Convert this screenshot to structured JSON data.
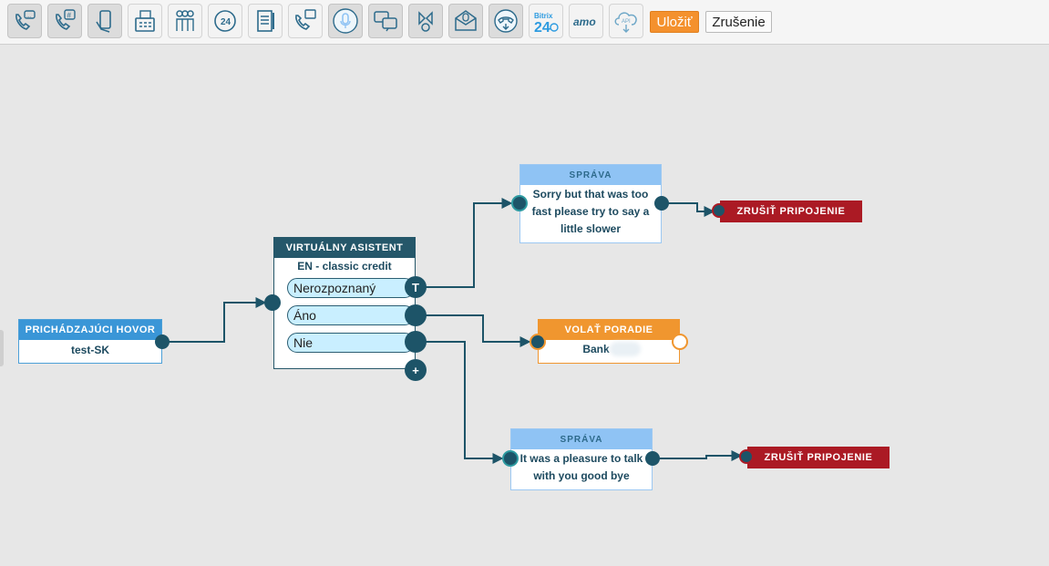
{
  "toolbar": {
    "tools": [
      {
        "icon": "sms-call-icon"
      },
      {
        "icon": "hash-call-icon"
      },
      {
        "icon": "mobile-hand-icon"
      },
      {
        "icon": "fax-icon"
      },
      {
        "icon": "people-queue-icon"
      },
      {
        "icon": "hours-24-icon"
      },
      {
        "icon": "notepad-icon"
      },
      {
        "icon": "call-transfer-icon"
      },
      {
        "icon": "microphone-icon"
      },
      {
        "icon": "chat-bubbles-icon"
      },
      {
        "icon": "conference-icon"
      },
      {
        "icon": "voicemail-icon"
      },
      {
        "icon": "hangup-icon"
      },
      {
        "icon": "bitrix24-icon",
        "label": "Bitrix 24"
      },
      {
        "icon": "amo-icon",
        "label": "amo"
      },
      {
        "icon": "api-cloud-icon",
        "label": "API"
      }
    ],
    "save_label": "Uložiť",
    "cancel_label": "Zrušenie"
  },
  "nodes": {
    "incoming": {
      "title": "PRICHÁDZAJÚCI HOVOR",
      "value": "test-SK"
    },
    "assistant": {
      "title": "VIRTUÁLNY ASISTENT",
      "subtitle": "EN - classic credit",
      "options": [
        "Nerozpoznaný",
        "Áno",
        "Nie"
      ],
      "timeout_label": "T",
      "add_label": "+"
    },
    "message1": {
      "title": "SPRÁVA",
      "text": "Sorry but that was too fast please try to say a little slower"
    },
    "message2": {
      "title": "SPRÁVA",
      "text": "It was a pleasure to talk with you good bye"
    },
    "queue": {
      "title": "VOLAŤ PORADIE",
      "value": "Bank"
    },
    "hangup1": {
      "title": "ZRUŠIŤ PRIPOJENIE"
    },
    "hangup2": {
      "title": "ZRUŠIŤ PRIPOJENIE"
    }
  },
  "colors": {
    "accent": "#f4912d",
    "wire": "#1d5468",
    "incoming": "#3a96d7",
    "assistant": "#25576a",
    "message": "#8fc3f4",
    "queue": "#f0962f",
    "hangup": "#ab1a24"
  }
}
